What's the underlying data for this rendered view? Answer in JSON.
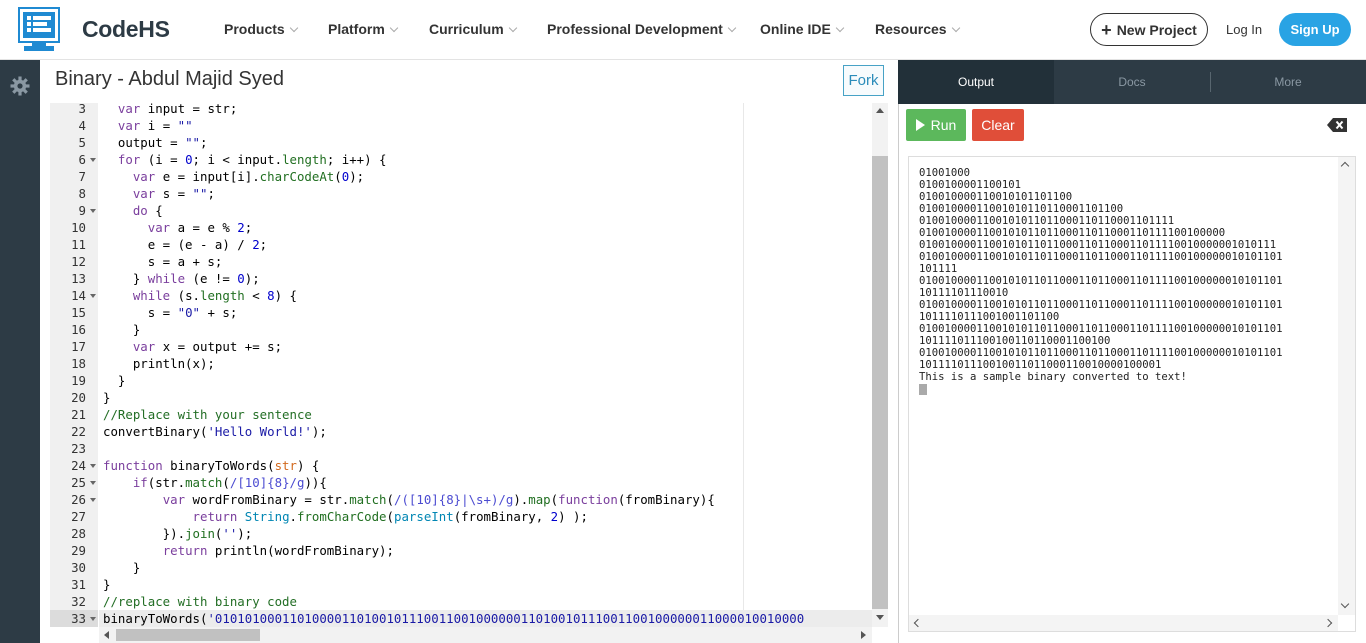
{
  "header": {
    "brand": "CodeHS",
    "nav": [
      "Products",
      "Platform",
      "Curriculum",
      "Professional Development",
      "Online IDE",
      "Resources"
    ],
    "new_project": "New Project",
    "login": "Log In",
    "signup": "Sign Up"
  },
  "editor": {
    "title": "Binary - Abdul Majid Syed",
    "fork_label": "Fork",
    "line_numbers": [
      "3",
      "4",
      "5",
      "6",
      "7",
      "8",
      "9",
      "10",
      "11",
      "12",
      "13",
      "14",
      "15",
      "16",
      "17",
      "18",
      "19",
      "20",
      "21",
      "22",
      "23",
      "24",
      "25",
      "26",
      "27",
      "28",
      "29",
      "30",
      "31",
      "32",
      "33"
    ],
    "active_line": "33",
    "code_lines": [
      "  var input = str;",
      "  var i = \"\"",
      "  output = \"\";",
      "  for (i = 0; i < input.length; i++) {",
      "    var e = input[i].charCodeAt(0);",
      "    var s = \"\";",
      "    do {",
      "      var a = e % 2;",
      "      e = (e - a) / 2;",
      "      s = a + s;",
      "    } while (e != 0);",
      "    while (s.length < 8) {",
      "      s = \"0\" + s;",
      "    }",
      "    var x = output += s;",
      "    println(x);",
      "  }",
      "}",
      "//Replace with your sentence",
      "convertBinary('Hello World!');",
      "",
      "function binaryToWords(str) {",
      "    if(str.match(/[10]{8}/g)){",
      "        var wordFromBinary = str.match(/([10]{8}|\\s+)/g).map(function(fromBinary){",
      "            return String.fromCharCode(parseInt(fromBinary, 2) );",
      "        }).join('');",
      "        return println(wordFromBinary);",
      "    }",
      "}",
      "//replace with binary code",
      "binaryToWords('0101010001101000011010010111001100100000011010010111001100100000011000010010000"
    ]
  },
  "panel": {
    "tabs": [
      "Output",
      "Docs",
      "More"
    ],
    "active_tab": "Output",
    "run_label": "Run",
    "clear_label": "Clear",
    "console_lines": [
      "01001000",
      "0100100001100101",
      "010010000110010101101100",
      "01001000011001010110110001101100",
      "0100100001100101011011000110110001101111",
      "010010000110010101101100011011000110111100100000",
      "01001000011001010110110001101100011011110010000001010111",
      "010010000110010101101100011011000110111100100000010101101",
      "101111",
      "010010000110010101101100011011000110111100100000010101101",
      "10111101110010",
      "010010000110010101101100011011000110111100100000010101101",
      "1011110111001001101100",
      "010010000110010101101100011011000110111100100000010101101",
      "101111011100100110110001100100",
      "010010000110010101101100011011000110111100100000010101101",
      "10111101110010011011000110010000100001",
      "This is a sample binary converted to text!"
    ]
  },
  "colors": {
    "nav_dark": "#2d3b45",
    "run_green": "#5cb85c",
    "clear_red": "#e04e39",
    "signup_blue": "#29a3e4"
  }
}
